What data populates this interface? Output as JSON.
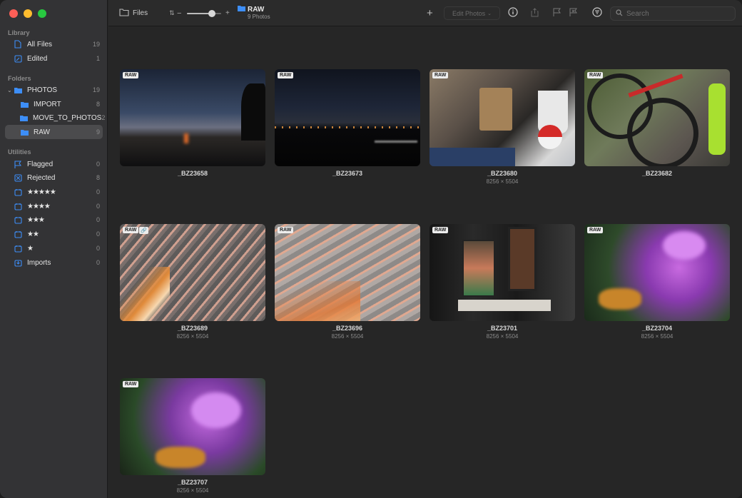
{
  "sidebar": {
    "library_header": "Library",
    "library": [
      {
        "label": "All Files",
        "count": "19",
        "icon": "document-icon"
      },
      {
        "label": "Edited",
        "count": "1",
        "icon": "edit-icon"
      }
    ],
    "folders_header": "Folders",
    "folders": [
      {
        "label": "PHOTOS",
        "count": "19"
      },
      {
        "label": "IMPORT",
        "count": "8"
      },
      {
        "label": "MOVE_TO_PHOTOS",
        "count": "2"
      },
      {
        "label": "RAW",
        "count": "9"
      }
    ],
    "utilities_header": "Utilities",
    "utilities": [
      {
        "label": "Flagged",
        "count": "0"
      },
      {
        "label": "Rejected",
        "count": "8"
      },
      {
        "label": "★★★★★",
        "count": "0"
      },
      {
        "label": "★★★★",
        "count": "0"
      },
      {
        "label": "★★★",
        "count": "0"
      },
      {
        "label": "★★",
        "count": "0"
      },
      {
        "label": "★",
        "count": "0"
      },
      {
        "label": "Imports",
        "count": "0"
      }
    ]
  },
  "toolbar": {
    "source_label": "Files",
    "zoom_minus": "−",
    "zoom_plus": "+",
    "zoom_level": 0.8,
    "folder_title": "RAW",
    "folder_subtitle": "9 Photos",
    "edit_label": "Edit Photos",
    "search_placeholder": "Search"
  },
  "photos": [
    {
      "name": "_BZ23658",
      "dims": "",
      "badge": "RAW",
      "link": false
    },
    {
      "name": "_BZ23673",
      "dims": "",
      "badge": "RAW",
      "link": false
    },
    {
      "name": "_BZ23680",
      "dims": "8256 × 5504",
      "badge": "RAW",
      "link": false
    },
    {
      "name": "_BZ23682",
      "dims": "",
      "badge": "RAW",
      "link": false
    },
    {
      "name": "_BZ23689",
      "dims": "8256 × 5504",
      "badge": "RAW",
      "link": true
    },
    {
      "name": "_BZ23696",
      "dims": "8256 × 5504",
      "badge": "RAW",
      "link": false
    },
    {
      "name": "_BZ23701",
      "dims": "8256 × 5504",
      "badge": "RAW",
      "link": false
    },
    {
      "name": "_BZ23704",
      "dims": "8256 × 5504",
      "badge": "RAW",
      "link": false
    },
    {
      "name": "_BZ23707",
      "dims": "8256 × 5504",
      "badge": "RAW",
      "link": false
    }
  ],
  "colors": {
    "accent": "#3d8ef7",
    "close": "#fe5f57",
    "minimize": "#febc2e",
    "zoom": "#28c840"
  }
}
